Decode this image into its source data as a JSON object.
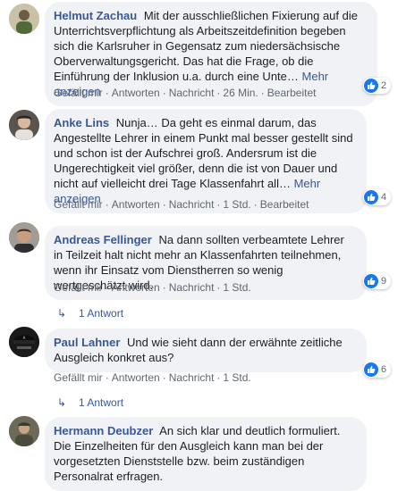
{
  "comments": [
    {
      "author": "Helmut Zachau",
      "text": "Mit der ausschließlichen Fixierung auf die Unterrichtsverpflichtung als Arbeitszeitdefinition begeben sich die Karlsruher in Gegensatz zum niedersächsische Oberverwaltungsgericht. Das hat die Frage, ob die Einführung der Inklusion u.a. durch eine Unte…",
      "more": "Mehr anzeigen",
      "like": "Gefällt mir",
      "reply": "Antworten",
      "message": "Nachricht",
      "time": "26 Min.",
      "edited": "Bearbeitet",
      "reactions": "2"
    },
    {
      "author": "Anke Lins",
      "text": "Nunja… Da geht es einmal darum, das Angestellte Lehrer in einem Punkt mal besser gestellt sind und schon ist der Aufschrei groß. Andersrum ist die Ungerechtigkeit viel größer, denn die ist von Dauer und nicht auf vielleicht drei Tage Klassenfahrt all…",
      "more": "Mehr anzeigen",
      "like": "Gefällt mir",
      "reply": "Antworten",
      "message": "Nachricht",
      "time": "1 Std.",
      "edited": "Bearbeitet",
      "reactions": "4"
    },
    {
      "author": "Andreas Fellinger",
      "text": "Na dann sollten verbeamtete Lehrer in Teilzeit halt nicht mehr an Klassenfahrten teilnehmen, wenn ihr Einsatz vom Dienstherren so wenig wertgeschätzt wird.",
      "like": "Gefällt mir",
      "reply": "Antworten",
      "message": "Nachricht",
      "time": "1 Std.",
      "reactions": "9",
      "replies": "1 Antwort"
    },
    {
      "author": "Paul Lahner",
      "text": "Und wie sieht dann der erwähnte zeitliche Ausgleich konkret aus?",
      "like": "Gefällt mir",
      "reply": "Antworten",
      "message": "Nachricht",
      "time": "1 Std.",
      "reactions": "6",
      "replies": "1 Antwort"
    },
    {
      "author": "Hermann Deubzer",
      "text": "An sich klar und deutlich formuliert. Die Einzelheiten für den Ausgleich kann man bei der vorgesetzten Dienststelle bzw. beim zuständigen Personalrat erfragen."
    }
  ],
  "colors": {
    "link": "#385898",
    "bubble": "#f0f2f5",
    "like": "#1877f2"
  }
}
